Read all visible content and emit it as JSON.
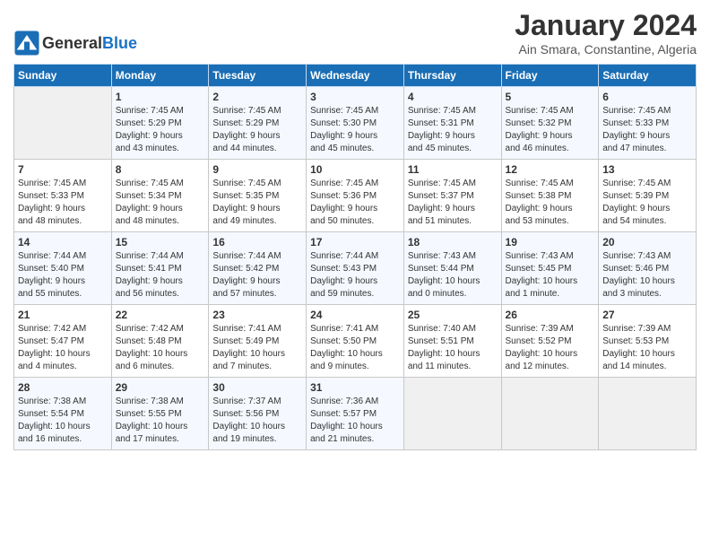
{
  "header": {
    "logo_general": "General",
    "logo_blue": "Blue",
    "title": "January 2024",
    "subtitle": "Ain Smara, Constantine, Algeria"
  },
  "weekdays": [
    "Sunday",
    "Monday",
    "Tuesday",
    "Wednesday",
    "Thursday",
    "Friday",
    "Saturday"
  ],
  "weeks": [
    [
      {
        "day": "",
        "info": ""
      },
      {
        "day": "1",
        "info": "Sunrise: 7:45 AM\nSunset: 5:29 PM\nDaylight: 9 hours\nand 43 minutes."
      },
      {
        "day": "2",
        "info": "Sunrise: 7:45 AM\nSunset: 5:29 PM\nDaylight: 9 hours\nand 44 minutes."
      },
      {
        "day": "3",
        "info": "Sunrise: 7:45 AM\nSunset: 5:30 PM\nDaylight: 9 hours\nand 45 minutes."
      },
      {
        "day": "4",
        "info": "Sunrise: 7:45 AM\nSunset: 5:31 PM\nDaylight: 9 hours\nand 45 minutes."
      },
      {
        "day": "5",
        "info": "Sunrise: 7:45 AM\nSunset: 5:32 PM\nDaylight: 9 hours\nand 46 minutes."
      },
      {
        "day": "6",
        "info": "Sunrise: 7:45 AM\nSunset: 5:33 PM\nDaylight: 9 hours\nand 47 minutes."
      }
    ],
    [
      {
        "day": "7",
        "info": "Sunrise: 7:45 AM\nSunset: 5:33 PM\nDaylight: 9 hours\nand 48 minutes."
      },
      {
        "day": "8",
        "info": "Sunrise: 7:45 AM\nSunset: 5:34 PM\nDaylight: 9 hours\nand 48 minutes."
      },
      {
        "day": "9",
        "info": "Sunrise: 7:45 AM\nSunset: 5:35 PM\nDaylight: 9 hours\nand 49 minutes."
      },
      {
        "day": "10",
        "info": "Sunrise: 7:45 AM\nSunset: 5:36 PM\nDaylight: 9 hours\nand 50 minutes."
      },
      {
        "day": "11",
        "info": "Sunrise: 7:45 AM\nSunset: 5:37 PM\nDaylight: 9 hours\nand 51 minutes."
      },
      {
        "day": "12",
        "info": "Sunrise: 7:45 AM\nSunset: 5:38 PM\nDaylight: 9 hours\nand 53 minutes."
      },
      {
        "day": "13",
        "info": "Sunrise: 7:45 AM\nSunset: 5:39 PM\nDaylight: 9 hours\nand 54 minutes."
      }
    ],
    [
      {
        "day": "14",
        "info": "Sunrise: 7:44 AM\nSunset: 5:40 PM\nDaylight: 9 hours\nand 55 minutes."
      },
      {
        "day": "15",
        "info": "Sunrise: 7:44 AM\nSunset: 5:41 PM\nDaylight: 9 hours\nand 56 minutes."
      },
      {
        "day": "16",
        "info": "Sunrise: 7:44 AM\nSunset: 5:42 PM\nDaylight: 9 hours\nand 57 minutes."
      },
      {
        "day": "17",
        "info": "Sunrise: 7:44 AM\nSunset: 5:43 PM\nDaylight: 9 hours\nand 59 minutes."
      },
      {
        "day": "18",
        "info": "Sunrise: 7:43 AM\nSunset: 5:44 PM\nDaylight: 10 hours\nand 0 minutes."
      },
      {
        "day": "19",
        "info": "Sunrise: 7:43 AM\nSunset: 5:45 PM\nDaylight: 10 hours\nand 1 minute."
      },
      {
        "day": "20",
        "info": "Sunrise: 7:43 AM\nSunset: 5:46 PM\nDaylight: 10 hours\nand 3 minutes."
      }
    ],
    [
      {
        "day": "21",
        "info": "Sunrise: 7:42 AM\nSunset: 5:47 PM\nDaylight: 10 hours\nand 4 minutes."
      },
      {
        "day": "22",
        "info": "Sunrise: 7:42 AM\nSunset: 5:48 PM\nDaylight: 10 hours\nand 6 minutes."
      },
      {
        "day": "23",
        "info": "Sunrise: 7:41 AM\nSunset: 5:49 PM\nDaylight: 10 hours\nand 7 minutes."
      },
      {
        "day": "24",
        "info": "Sunrise: 7:41 AM\nSunset: 5:50 PM\nDaylight: 10 hours\nand 9 minutes."
      },
      {
        "day": "25",
        "info": "Sunrise: 7:40 AM\nSunset: 5:51 PM\nDaylight: 10 hours\nand 11 minutes."
      },
      {
        "day": "26",
        "info": "Sunrise: 7:39 AM\nSunset: 5:52 PM\nDaylight: 10 hours\nand 12 minutes."
      },
      {
        "day": "27",
        "info": "Sunrise: 7:39 AM\nSunset: 5:53 PM\nDaylight: 10 hours\nand 14 minutes."
      }
    ],
    [
      {
        "day": "28",
        "info": "Sunrise: 7:38 AM\nSunset: 5:54 PM\nDaylight: 10 hours\nand 16 minutes."
      },
      {
        "day": "29",
        "info": "Sunrise: 7:38 AM\nSunset: 5:55 PM\nDaylight: 10 hours\nand 17 minutes."
      },
      {
        "day": "30",
        "info": "Sunrise: 7:37 AM\nSunset: 5:56 PM\nDaylight: 10 hours\nand 19 minutes."
      },
      {
        "day": "31",
        "info": "Sunrise: 7:36 AM\nSunset: 5:57 PM\nDaylight: 10 hours\nand 21 minutes."
      },
      {
        "day": "",
        "info": ""
      },
      {
        "day": "",
        "info": ""
      },
      {
        "day": "",
        "info": ""
      }
    ]
  ]
}
